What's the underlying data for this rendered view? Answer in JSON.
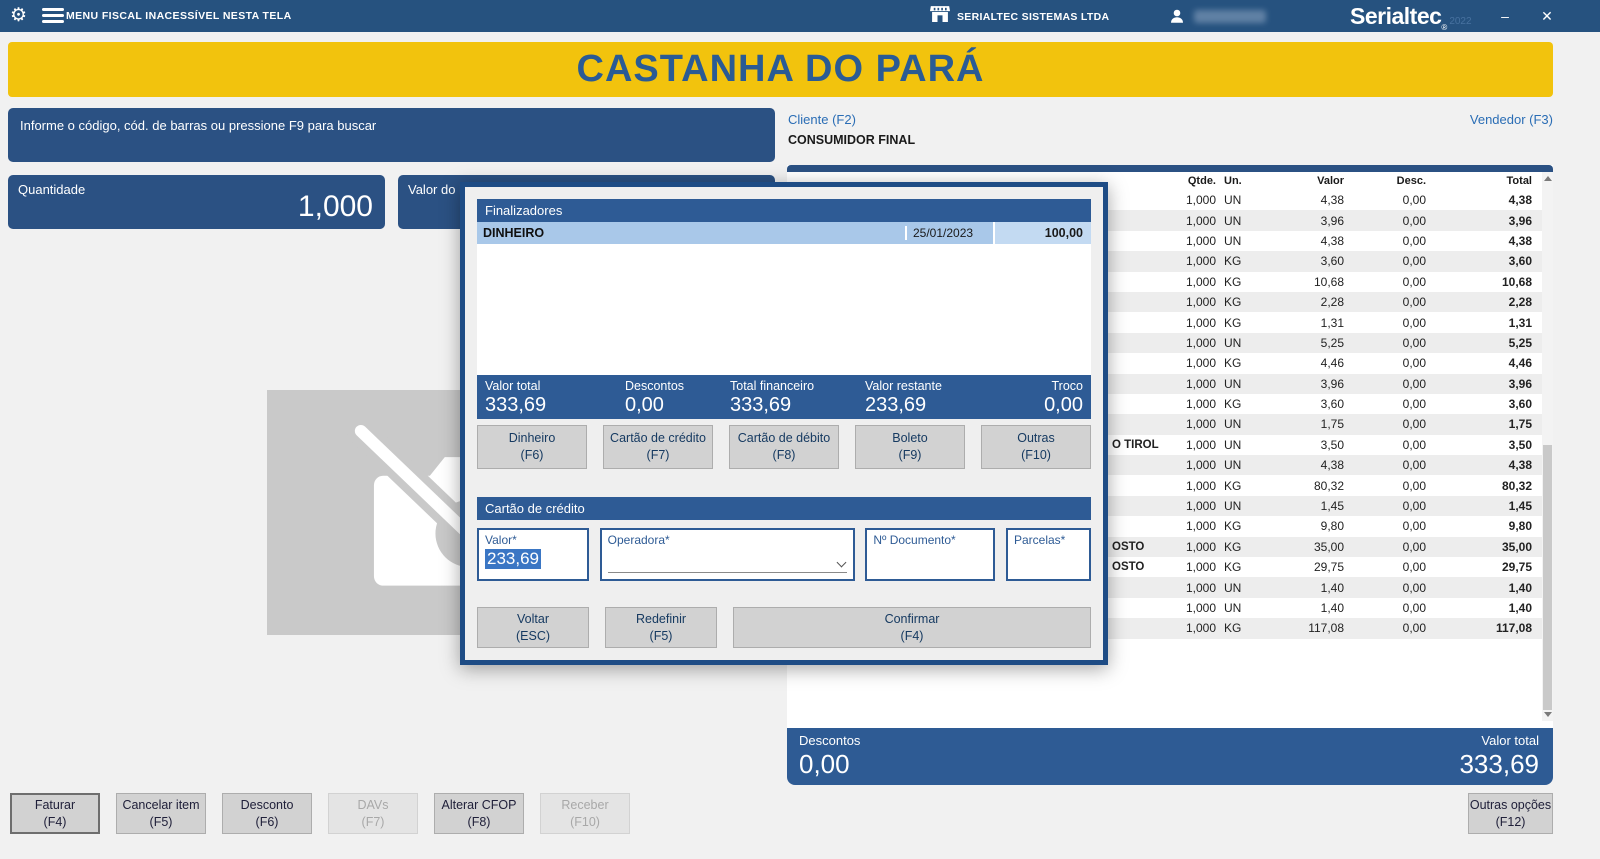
{
  "colors": {
    "titlebar": "#26527f",
    "accent_blue": "#2e5b95",
    "box_blue": "#2b5183",
    "banner_yellow": "#f2c30d",
    "banner_text_blue": "#2a5b94",
    "selected_row_blue": "#a9c8e9",
    "text_selection_blue": "#3a76c4"
  },
  "icons": {
    "gear": "⚙",
    "minimize": "–",
    "close": "✕"
  },
  "titlebar": {
    "menu_text": "MENU FISCAL INACESSÍVEL NESTA TELA",
    "company": "SERIALTEC SISTEMAS LTDA",
    "logo": "Serialtec",
    "logo_reg": "®",
    "logo_year": "2022"
  },
  "banner": {
    "title": "CASTANHA DO PARÁ"
  },
  "search": {
    "placeholder": "Informe o código, cód. de barras ou pressione F9 para buscar"
  },
  "customer": {
    "label": "Cliente (F2)",
    "value": "CONSUMIDOR FINAL"
  },
  "vendor": {
    "label": "Vendedor (F3)"
  },
  "quantity": {
    "label": "Quantidade",
    "value": "1,000"
  },
  "item_value": {
    "label": "Valor do it"
  },
  "items_table": {
    "headers": {
      "qty": "Qtde.",
      "unit": "Un.",
      "value": "Valor",
      "discount": "Desc.",
      "total": "Total"
    },
    "rows": [
      {
        "name": "",
        "qty": "1,000",
        "un": "UN",
        "value": "4,38",
        "discount": "0,00",
        "total": "4,38"
      },
      {
        "name": "",
        "qty": "1,000",
        "un": "UN",
        "value": "3,96",
        "discount": "0,00",
        "total": "3,96"
      },
      {
        "name": "",
        "qty": "1,000",
        "un": "UN",
        "value": "4,38",
        "discount": "0,00",
        "total": "4,38"
      },
      {
        "name": "",
        "qty": "1,000",
        "un": "KG",
        "value": "3,60",
        "discount": "0,00",
        "total": "3,60"
      },
      {
        "name": "",
        "qty": "1,000",
        "un": "KG",
        "value": "10,68",
        "discount": "0,00",
        "total": "10,68"
      },
      {
        "name": "",
        "qty": "1,000",
        "un": "KG",
        "value": "2,28",
        "discount": "0,00",
        "total": "2,28"
      },
      {
        "name": "",
        "qty": "1,000",
        "un": "KG",
        "value": "1,31",
        "discount": "0,00",
        "total": "1,31"
      },
      {
        "name": "",
        "qty": "1,000",
        "un": "UN",
        "value": "5,25",
        "discount": "0,00",
        "total": "5,25"
      },
      {
        "name": "",
        "qty": "1,000",
        "un": "KG",
        "value": "4,46",
        "discount": "0,00",
        "total": "4,46"
      },
      {
        "name": "",
        "qty": "1,000",
        "un": "UN",
        "value": "3,96",
        "discount": "0,00",
        "total": "3,96"
      },
      {
        "name": "",
        "qty": "1,000",
        "un": "KG",
        "value": "3,60",
        "discount": "0,00",
        "total": "3,60"
      },
      {
        "name": "",
        "qty": "1,000",
        "un": "UN",
        "value": "1,75",
        "discount": "0,00",
        "total": "1,75"
      },
      {
        "name": "O TIROL",
        "qty": "1,000",
        "un": "UN",
        "value": "3,50",
        "discount": "0,00",
        "total": "3,50"
      },
      {
        "name": "",
        "qty": "1,000",
        "un": "UN",
        "value": "4,38",
        "discount": "0,00",
        "total": "4,38"
      },
      {
        "name": "",
        "qty": "1,000",
        "un": "KG",
        "value": "80,32",
        "discount": "0,00",
        "total": "80,32"
      },
      {
        "name": "",
        "qty": "1,000",
        "un": "UN",
        "value": "1,45",
        "discount": "0,00",
        "total": "1,45"
      },
      {
        "name": "",
        "qty": "1,000",
        "un": "KG",
        "value": "9,80",
        "discount": "0,00",
        "total": "9,80"
      },
      {
        "name": "OSTO",
        "qty": "1,000",
        "un": "KG",
        "value": "35,00",
        "discount": "0,00",
        "total": "35,00"
      },
      {
        "name": "OSTO",
        "qty": "1,000",
        "un": "KG",
        "value": "29,75",
        "discount": "0,00",
        "total": "29,75"
      },
      {
        "name": "",
        "qty": "1,000",
        "un": "UN",
        "value": "1,40",
        "discount": "0,00",
        "total": "1,40"
      },
      {
        "name": "",
        "qty": "1,000",
        "un": "UN",
        "value": "1,40",
        "discount": "0,00",
        "total": "1,40"
      },
      {
        "name": "",
        "qty": "1,000",
        "un": "KG",
        "value": "117,08",
        "discount": "0,00",
        "total": "117,08"
      }
    ]
  },
  "summary": {
    "discount_label": "Descontos",
    "discount_value": "0,00",
    "total_label": "Valor total",
    "total_value": "333,69"
  },
  "modal": {
    "title": "Finalizadores",
    "entries": [
      {
        "name": "DINHEIRO",
        "date": "25/01/2023",
        "amount": "100,00"
      }
    ],
    "totals": [
      {
        "label": "Valor total",
        "value": "333,69"
      },
      {
        "label": "Descontos",
        "value": "0,00"
      },
      {
        "label": "Total financeiro",
        "value": "333,69"
      },
      {
        "label": "Valor restante",
        "value": "233,69"
      },
      {
        "label": "Troco",
        "value": "0,00"
      }
    ],
    "methods": [
      {
        "label": "Dinheiro",
        "key": "(F6)"
      },
      {
        "label": "Cartão de crédito",
        "key": "(F7)"
      },
      {
        "label": "Cartão de débito",
        "key": "(F8)"
      },
      {
        "label": "Boleto",
        "key": "(F9)"
      },
      {
        "label": "Outras",
        "key": "(F10)"
      }
    ],
    "section_title": "Cartão de crédito",
    "fields": {
      "valor": {
        "label": "Valor*",
        "value": "233,69"
      },
      "operadora": {
        "label": "Operadora*",
        "value": ""
      },
      "documento": {
        "label": "Nº Documento*",
        "value": ""
      },
      "parcelas": {
        "label": "Parcelas*",
        "value": ""
      }
    },
    "actions": [
      {
        "label": "Voltar",
        "key": "(ESC)"
      },
      {
        "label": "Redefinir",
        "key": "(F5)"
      },
      {
        "label": "Confirmar",
        "key": "(F4)",
        "wide": true
      }
    ]
  },
  "footer": {
    "buttons": [
      {
        "label": "Faturar",
        "key": "(F4)",
        "disabled": false,
        "focused": true
      },
      {
        "label": "Cancelar item",
        "key": "(F5)",
        "disabled": false
      },
      {
        "label": "Desconto",
        "key": "(F6)",
        "disabled": false
      },
      {
        "label": "DAVs",
        "key": "(F7)",
        "disabled": true
      },
      {
        "label": "Alterar CFOP",
        "key": "(F8)",
        "disabled": false
      },
      {
        "label": "Receber",
        "key": "(F10)",
        "disabled": true
      }
    ],
    "more_button": {
      "label": "Outras opções",
      "key": "(F12)"
    }
  }
}
